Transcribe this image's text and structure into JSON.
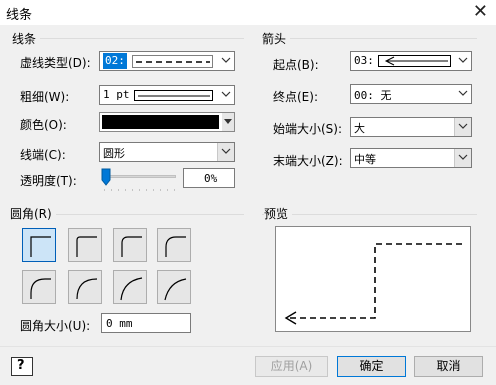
{
  "window": {
    "title": "线条",
    "close_glyph": "✕"
  },
  "line_group": {
    "heading": "线条",
    "dash_type": {
      "label": "虚线类型(D):",
      "value": "02:"
    },
    "weight": {
      "label": "粗细(W):",
      "value": "1 pt"
    },
    "color": {
      "label": "颜色(O):",
      "value": "#000000"
    },
    "cap": {
      "label": "线端(C):",
      "value": "圆形"
    },
    "transparency": {
      "label": "透明度(T):",
      "value": "0%",
      "level": 0
    }
  },
  "arrow_group": {
    "heading": "箭头",
    "begin": {
      "label": "起点(B):",
      "value": "03:"
    },
    "end": {
      "label": "终点(E):",
      "value": "00: 无"
    },
    "begin_size": {
      "label": "始端大小(S):",
      "value": "大"
    },
    "end_size": {
      "label": "末端大小(Z):",
      "value": "中等"
    }
  },
  "corner_group": {
    "heading": "圆角(R)",
    "size_label": "圆角大小(U):",
    "size_value": "0 mm"
  },
  "preview_group": {
    "heading": "预览"
  },
  "buttons": {
    "help": "?",
    "apply": "应用(A)",
    "ok": "确定",
    "cancel": "取消"
  },
  "colors": {
    "accent": "#0078d7",
    "selected_bg": "#cce4f7"
  }
}
